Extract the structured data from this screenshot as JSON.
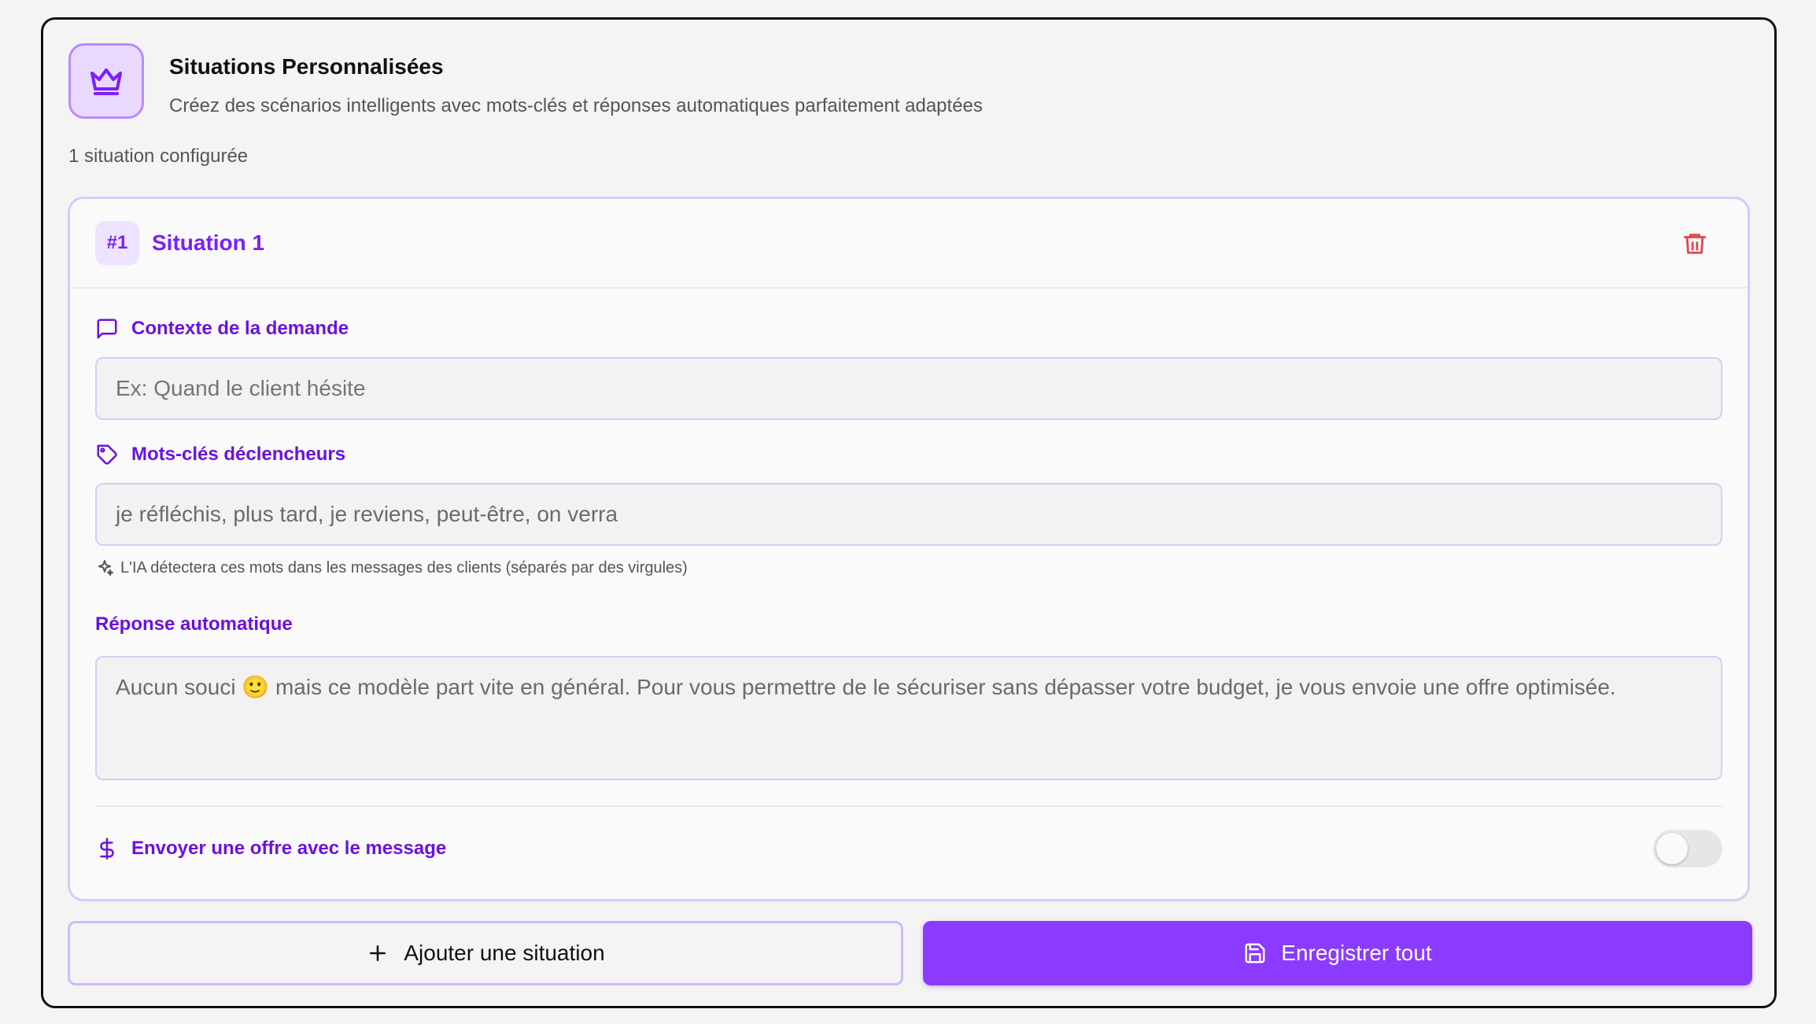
{
  "header": {
    "title": "Situations Personnalisées",
    "subtitle": "Créez des scénarios intelligents avec mots-clés et réponses automatiques parfaitement adaptées",
    "icon": "crown-icon"
  },
  "situation_count": "1 situation configurée",
  "situation": {
    "badge": "#1",
    "title": "Situation 1",
    "delete_icon": "trash-icon",
    "context": {
      "label": "Contexte de la demande",
      "icon": "message-square-icon",
      "placeholder": "Ex: Quand le client hésite",
      "value": ""
    },
    "keywords": {
      "label": "Mots-clés déclencheurs",
      "icon": "tag-icon",
      "value": "je réfléchis, plus tard, je reviens, peut-être, on verra",
      "hint": "L'IA détectera ces mots dans les messages des clients (séparés par des virgules)",
      "hint_icon": "sparkles-icon"
    },
    "reply": {
      "label": "Réponse automatique",
      "value": "Aucun souci 🙂 mais ce modèle part vite en général. Pour vous permettre de le sécuriser sans dépasser votre budget, je vous envoie une offre optimisée."
    },
    "offer": {
      "label": "Envoyer une offre avec le message",
      "icon": "dollar-sign-icon",
      "enabled": false
    }
  },
  "buttons": {
    "add_label": "Ajouter une situation",
    "save_label": "Enregistrer tout"
  },
  "colors": {
    "accent": "#8a3bff",
    "accent_text": "#6b12e0",
    "danger": "#e5484d"
  }
}
